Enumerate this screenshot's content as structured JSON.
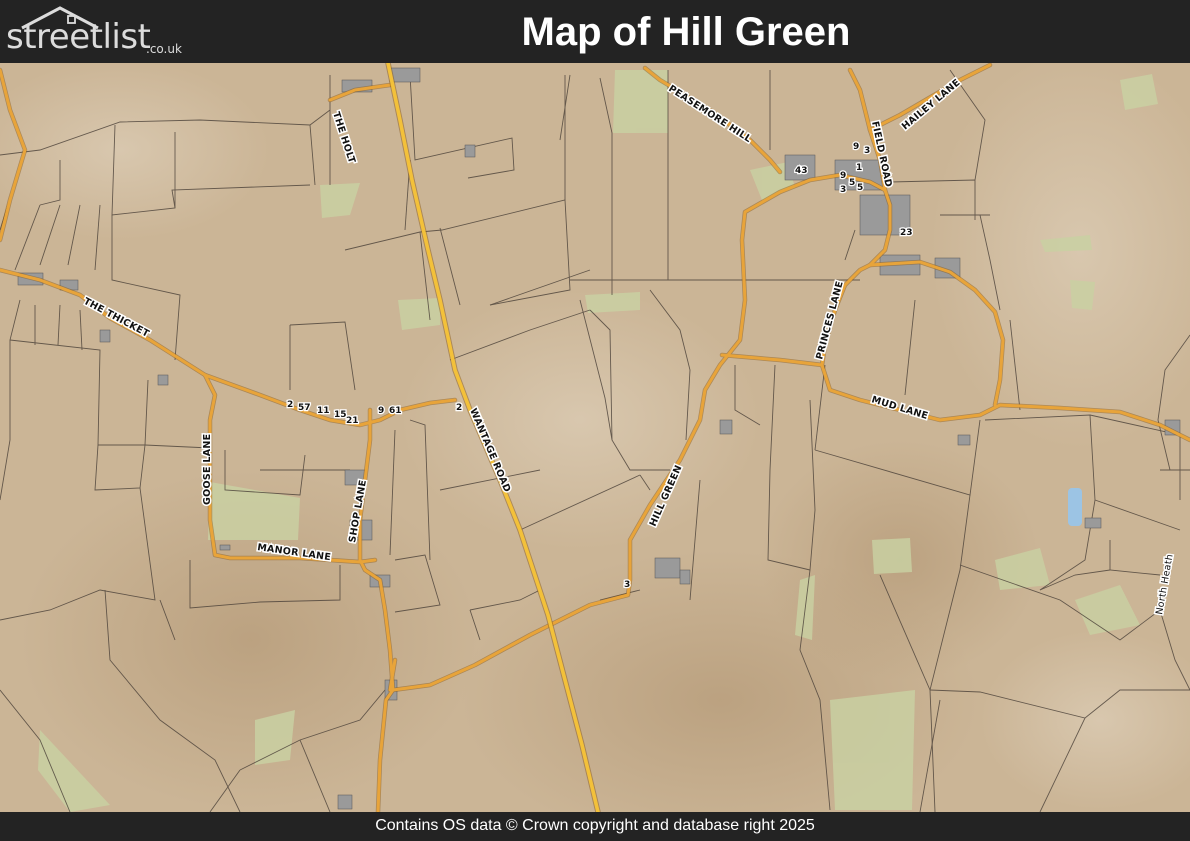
{
  "header": {
    "logo_text": "streetlist",
    "logo_suffix": ".co.uk",
    "title": "Map of Hill Green"
  },
  "map": {
    "road_labels": {
      "the_holt": "THE HOLT",
      "peasemore_hill": "PEASEMORE HILL",
      "field_road": "FIELD ROAD",
      "hailey_lane": "HAILEY LANE",
      "the_thicket": "THE THICKET",
      "princes_lane": "PRINCES LANE",
      "mud_lane": "MUD LANE",
      "wantage_road": "WANTAGE ROAD",
      "goose_lane": "GOOSE LANE",
      "shop_lane": "SHOP LANE",
      "manor_lane": "MANOR LANE",
      "hill_green": "HILL GREEN",
      "north_heath": "North Heath"
    },
    "house_numbers": {
      "h1": "2",
      "h2": "57",
      "h3": "11",
      "h4": "15",
      "h5": "21",
      "h6": "9",
      "h7": "61",
      "h8": "2",
      "h9": "3",
      "h10": "43",
      "h11": "9",
      "h12": "3",
      "h13": "1",
      "h14": "9",
      "h15": "5",
      "h16": "3",
      "h17": "5",
      "h18": "23"
    },
    "colors": {
      "land": "#cbb596",
      "road_major": "#f3c13a",
      "road_minor": "#e6a63a",
      "field_line": "#4a4038",
      "green_patch": "#c9d0a2",
      "water": "#9cc4e4"
    }
  },
  "footer": {
    "attribution": "Contains OS data © Crown copyright and database right 2025"
  }
}
